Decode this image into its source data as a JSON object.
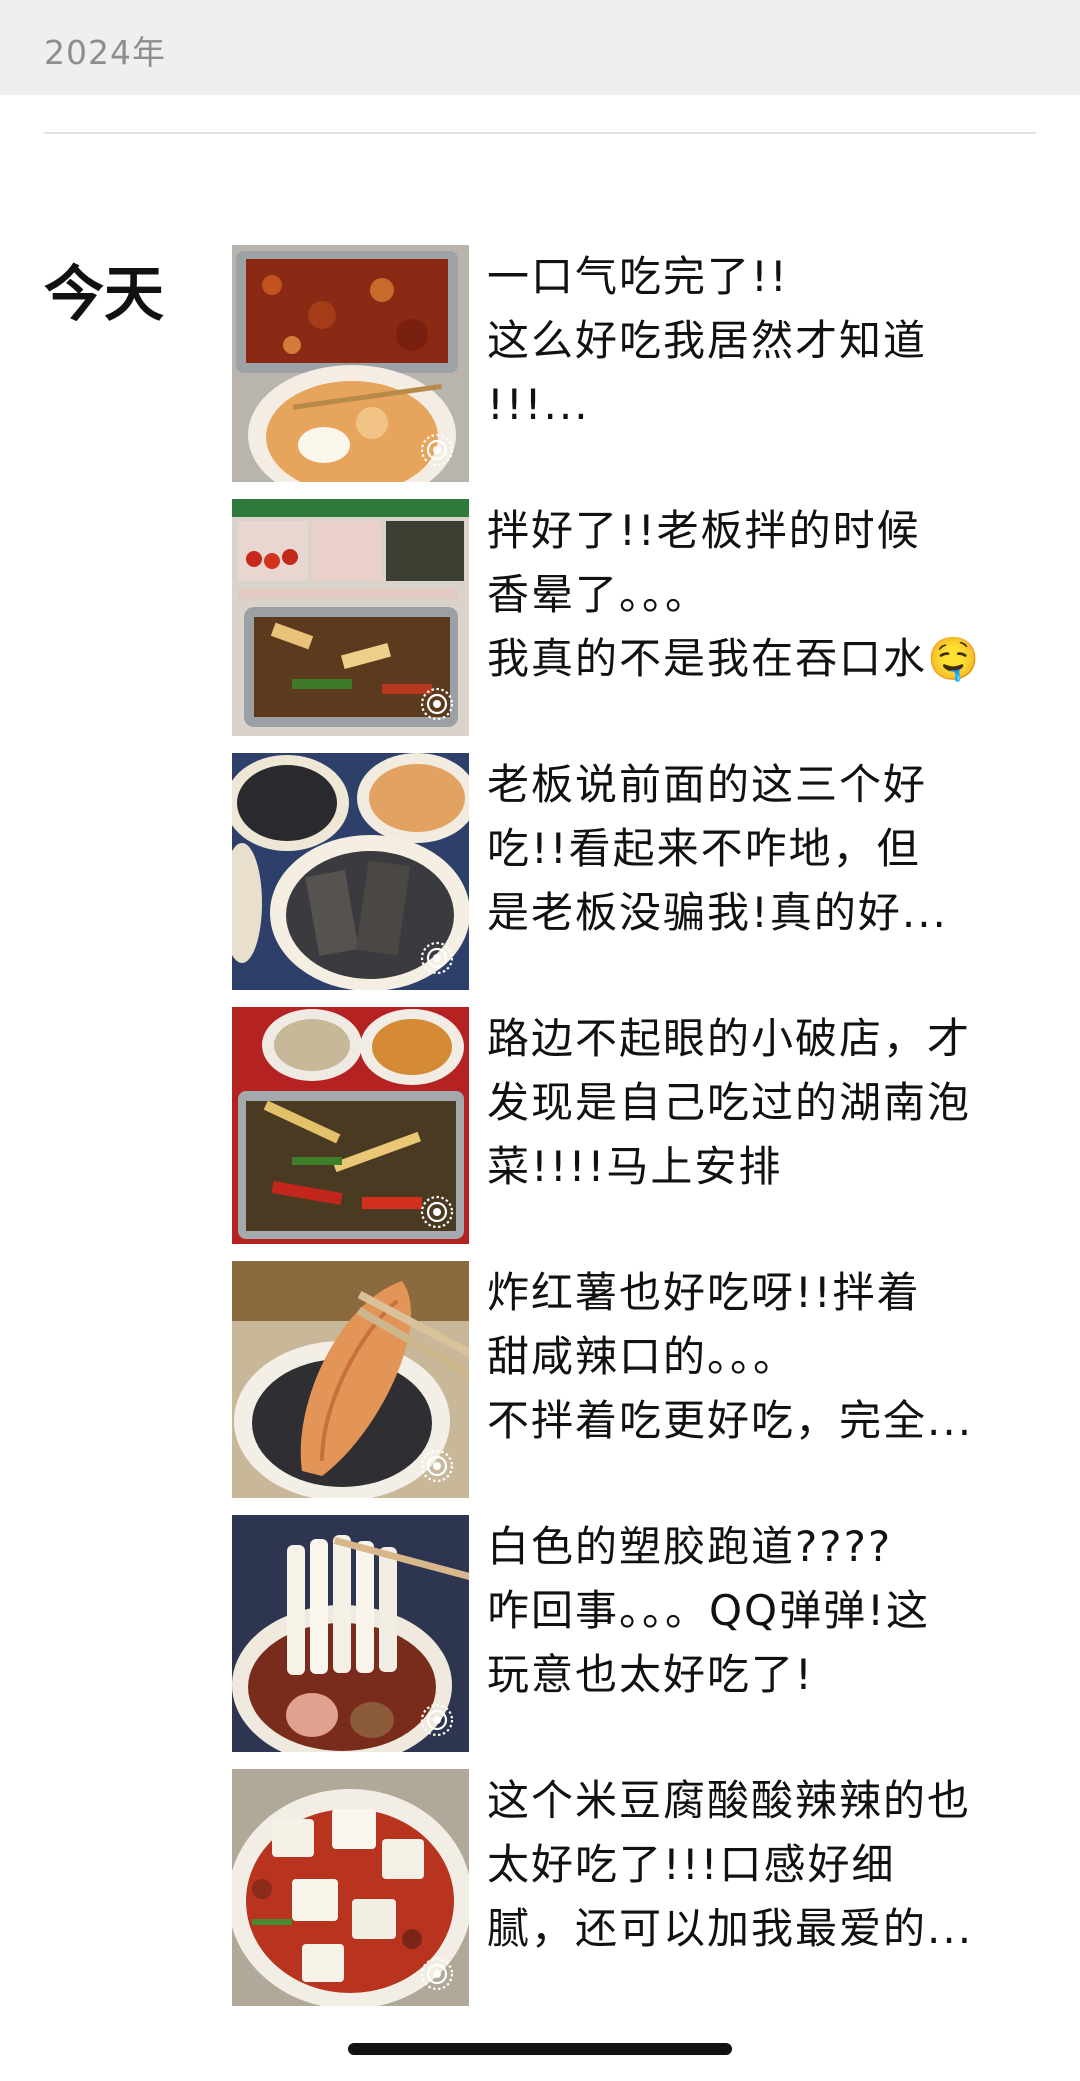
{
  "header": {
    "year": "2024年"
  },
  "timeline": {
    "day_label": "今天"
  },
  "posts": [
    {
      "caption": "一口气吃完了!!\n这么好吃我居然才知道\n!!!...",
      "thumb_icon": "live-photo-icon"
    },
    {
      "caption": "拌好了!!老板拌的时候\n香晕了。。。\n我真的不是我在吞口水🤤",
      "thumb_icon": "live-photo-icon"
    },
    {
      "caption": "老板说前面的这三个好\n吃!!看起来不咋地，但\n是老板没骗我!真的好...",
      "thumb_icon": "live-photo-icon"
    },
    {
      "caption": "路边不起眼的小破店，才\n发现是自己吃过的湖南泡\n菜!!!!马上安排",
      "thumb_icon": "live-photo-icon"
    },
    {
      "caption": "炸红薯也好吃呀!!拌着\n甜咸辣口的。。。\n不拌着吃更好吃，完全...",
      "thumb_icon": "live-photo-icon"
    },
    {
      "caption": "白色的塑胶跑道????\n咋回事。。。QQ弹弹!这\n玩意也太好吃了!",
      "thumb_icon": "live-photo-icon"
    },
    {
      "caption": "这个米豆腐酸酸辣辣的也\n太好吃了!!!口感好细\n腻，还可以加我最爱的...",
      "thumb_icon": "live-photo-icon"
    }
  ],
  "colors": {
    "top_band": "#efefef",
    "year_text": "#8e8e8e",
    "text": "#111111"
  }
}
